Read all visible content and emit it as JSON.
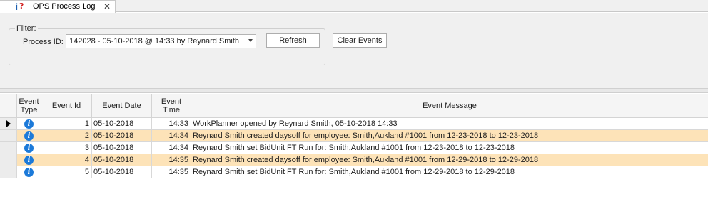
{
  "tab": {
    "title": "OPS Process Log",
    "close_glyph": "✕",
    "icon_letters": "i?"
  },
  "filter": {
    "group_title": "Filter:",
    "process_label": "Process ID:",
    "process_value": "142028 - 05-10-2018 @ 14:33 by Reynard Smith",
    "refresh_label": "Refresh",
    "clear_label": "Clear Events"
  },
  "grid": {
    "columns": {
      "event_type": "Event Type",
      "event_id": "Event Id",
      "event_date": "Event Date",
      "event_time": "Event Time",
      "event_message": "Event Message"
    },
    "rows": [
      {
        "id": "1",
        "date": "05-10-2018",
        "time": "14:33",
        "message": "WorkPlanner opened by Reynard Smith, 05-10-2018 14:33"
      },
      {
        "id": "2",
        "date": "05-10-2018",
        "time": "14:34",
        "message": "Reynard Smith created daysoff for employee: Smith,Aukland #1001 from 12-23-2018 to 12-23-2018"
      },
      {
        "id": "3",
        "date": "05-10-2018",
        "time": "14:34",
        "message": "Reynard Smith set BidUnit FT Run for: Smith,Aukland #1001 from 12-23-2018 to 12-23-2018"
      },
      {
        "id": "4",
        "date": "05-10-2018",
        "time": "14:35",
        "message": "Reynard Smith created daysoff for employee: Smith,Aukland #1001 from 12-29-2018 to 12-29-2018"
      },
      {
        "id": "5",
        "date": "05-10-2018",
        "time": "14:35",
        "message": "Reynard Smith set BidUnit FT Run for: Smith,Aukland #1001 from 12-29-2018 to 12-29-2018"
      }
    ]
  },
  "colors": {
    "alt_row": "#fde3b8",
    "info_icon": "#1c7ad9"
  }
}
